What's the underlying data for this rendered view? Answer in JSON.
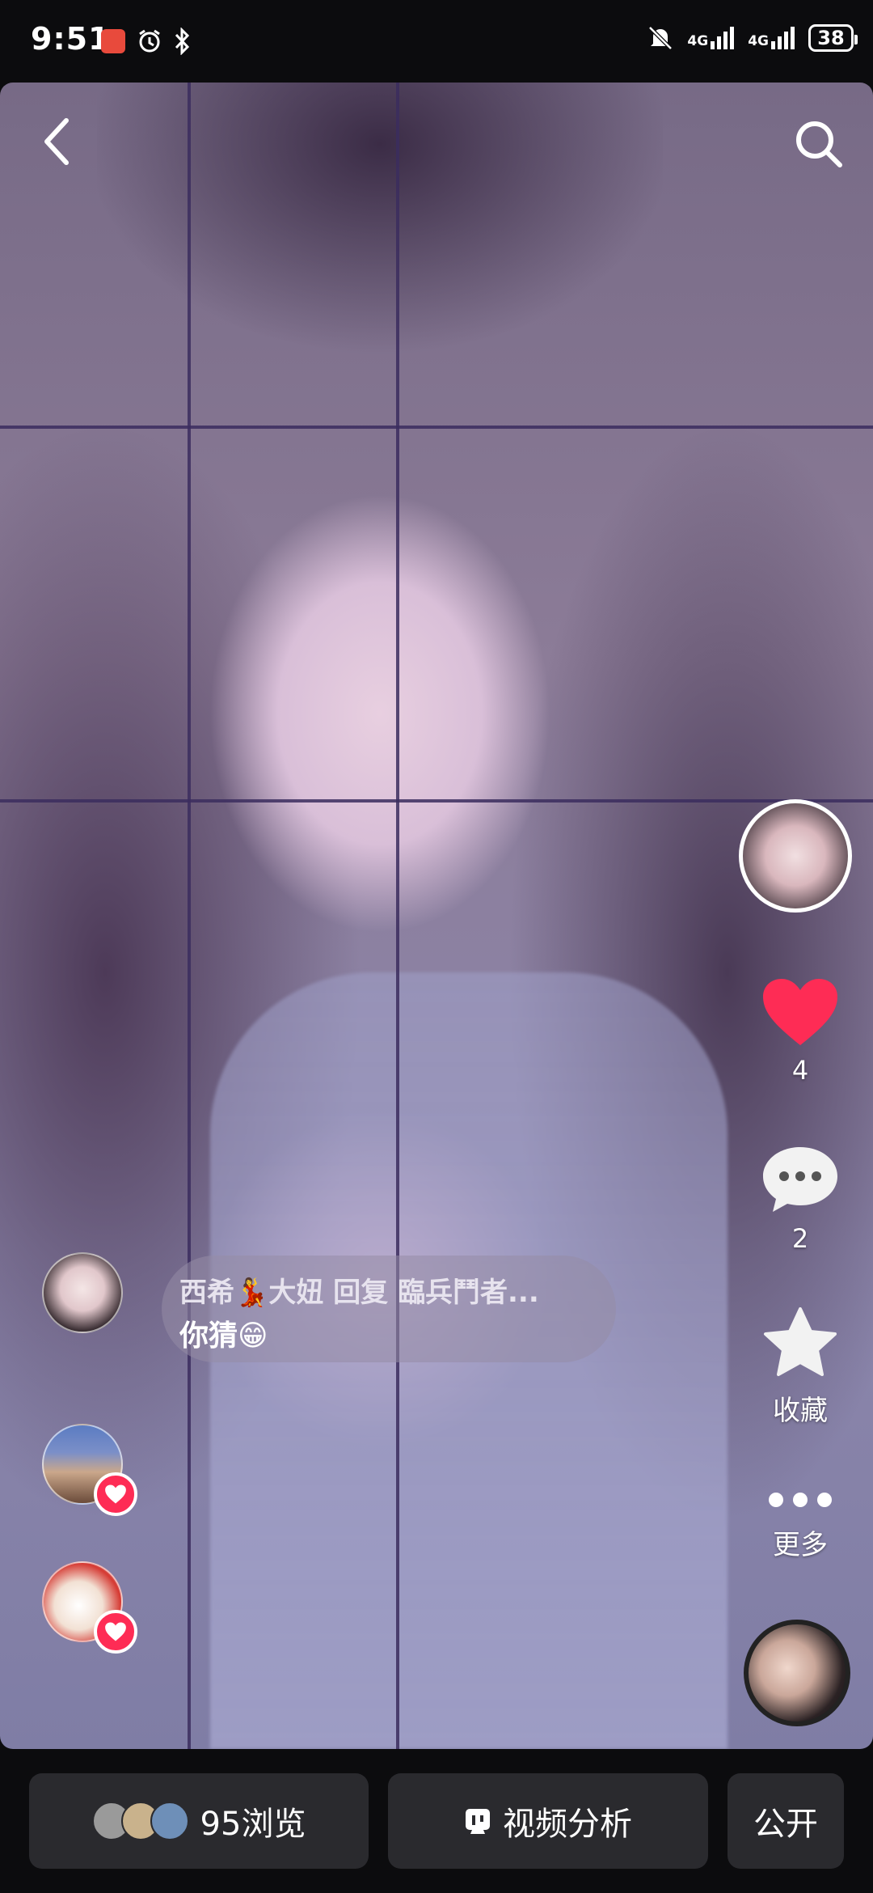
{
  "status_bar": {
    "time": "9:51",
    "network_1": "4G",
    "network_2": "4G",
    "battery": "38"
  },
  "video": {
    "right_rail": {
      "like_count": "4",
      "comment_count": "2",
      "favorite_label": "收藏",
      "more_label": "更多"
    },
    "comment": {
      "author": "西希💃大妞 回复 臨兵鬥者...",
      "text": "你猜😁"
    }
  },
  "bottom_bar": {
    "views_label": "95浏览",
    "analysis_label": "视频分析",
    "public_label": "公开"
  },
  "colors": {
    "like": "#fe2c55",
    "background": "#0c0c0e",
    "button_bg": "#2a2a2e"
  }
}
